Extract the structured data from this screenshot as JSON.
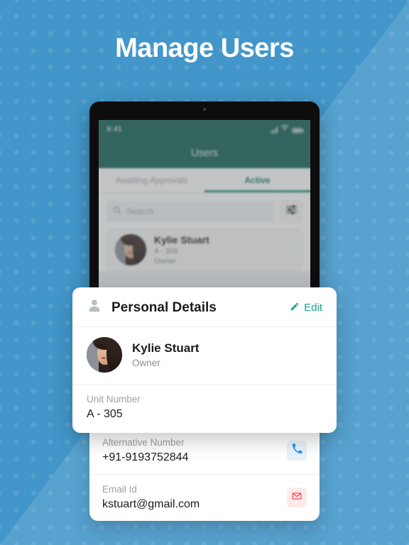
{
  "page": {
    "title": "Manage Users",
    "background_color": "#4296c9",
    "accent_teal": "#13907c",
    "accent_edit": "#18a78c"
  },
  "device": {
    "status_bar": {
      "time": "9:41",
      "signal_icon": "cellular-signal-icon",
      "wifi_icon": "wifi-icon",
      "battery_icon": "battery-icon"
    },
    "app_header": {
      "title": "Users"
    },
    "tabs": [
      {
        "label": "Awaiting Approvals",
        "active": false
      },
      {
        "label": "Active",
        "active": true
      }
    ],
    "search": {
      "placeholder": "Search",
      "search_icon": "search-icon",
      "filter_icon": "filter-sliders-icon"
    },
    "user_list": [
      {
        "name": "Kylie Stuart",
        "unit": "A - 305",
        "role": "Owner",
        "avatar": "user-avatar-photo"
      }
    ]
  },
  "personal_details": {
    "header": {
      "icon": "person-icon",
      "title": "Personal Details",
      "edit_label": "Edit",
      "edit_icon": "pencil-icon"
    },
    "person": {
      "name": "Kylie Stuart",
      "role": "Owner",
      "avatar": "user-avatar-photo"
    },
    "unit": {
      "label": "Unit Number",
      "value": "A - 305"
    }
  },
  "contact_details": {
    "rows": [
      {
        "label": "Alternative Number",
        "value": "+91-9193752844",
        "action_icon": "phone-icon",
        "action_color": "#2196f3"
      },
      {
        "label": "Email Id",
        "value": "kstuart@gmail.com",
        "action_icon": "envelope-icon",
        "action_color": "#f4433a"
      }
    ]
  }
}
